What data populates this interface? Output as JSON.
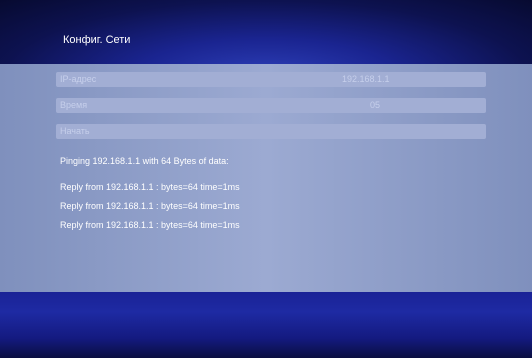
{
  "header": {
    "title": "Конфиг. Сети"
  },
  "form": {
    "rows": [
      {
        "label": "IP-адрес",
        "value": "192.168.1.1"
      },
      {
        "label": "Время",
        "value": "05"
      },
      {
        "label": "Начать",
        "value": ""
      }
    ]
  },
  "output": {
    "ping_line": "Pinging 192.168.1.1 with 64 Bytes of data:",
    "replies": [
      "Reply from 192.168.1.1 : bytes=64 time=1ms",
      "Reply from 192.168.1.1 : bytes=64 time=1ms",
      "Reply from 192.168.1.1 : bytes=64 time=1ms"
    ]
  },
  "colors": {
    "header_bg": "#1a2490",
    "content_bg": "#9caad2",
    "row_bg": "#a2aed4",
    "text_white": "#ffffff"
  }
}
